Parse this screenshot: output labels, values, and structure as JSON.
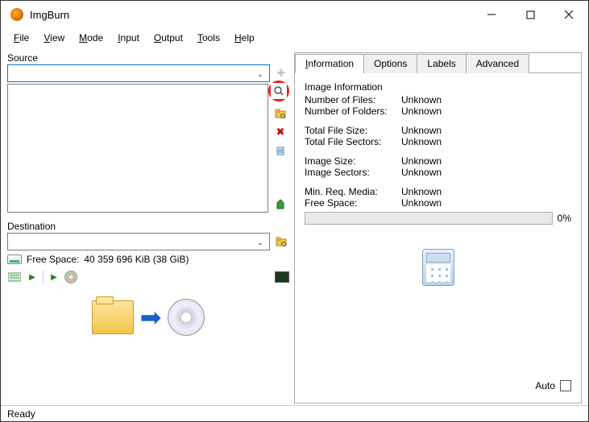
{
  "title": "ImgBurn",
  "menu": {
    "file": "File",
    "view": "View",
    "mode": "Mode",
    "input": "Input",
    "output": "Output",
    "tools": "Tools",
    "help": "Help"
  },
  "left": {
    "source_label": "Source",
    "destination_label": "Destination",
    "free_space_label": "Free Space:",
    "free_space_value": "40 359 696 KiB  (38 GiB)"
  },
  "right": {
    "tabs": {
      "information": "Information",
      "options": "Options",
      "labels": "Labels",
      "advanced": "Advanced"
    },
    "info": {
      "section_title": "Image Information",
      "num_files_label": "Number of Files:",
      "num_files_value": "Unknown",
      "num_folders_label": "Number of Folders:",
      "num_folders_value": "Unknown",
      "total_size_label": "Total File Size:",
      "total_size_value": "Unknown",
      "total_sectors_label": "Total File Sectors:",
      "total_sectors_value": "Unknown",
      "image_size_label": "Image Size:",
      "image_size_value": "Unknown",
      "image_sectors_label": "Image Sectors:",
      "image_sectors_value": "Unknown",
      "min_media_label": "Min. Req. Media:",
      "min_media_value": "Unknown",
      "free_space_label": "Free Space:",
      "free_space_value": "Unknown",
      "progress_pct": "0%",
      "auto_label": "Auto"
    }
  },
  "status": "Ready"
}
